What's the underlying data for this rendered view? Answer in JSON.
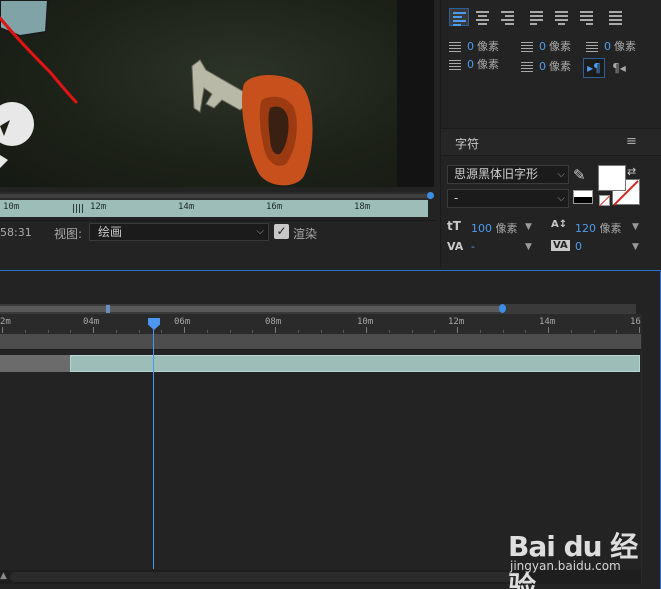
{
  "viewer": {
    "ruler_labels": [
      "10m",
      "12m",
      "14m",
      "16m",
      "18m"
    ],
    "timecode_fragment": "58:31",
    "view_label": "视图:",
    "view_value": "绘画",
    "render_label": "渲染"
  },
  "paragraph": {
    "indent_left": {
      "value": "0",
      "unit": "像素"
    },
    "indent_first": {
      "value": "0",
      "unit": "像素"
    },
    "indent_right": {
      "value": "0",
      "unit": "像素"
    },
    "space_before": {
      "value": "0",
      "unit": "像素"
    },
    "space_after": {
      "value": "0",
      "unit": "像素"
    },
    "ltr_symbol": "▸¶",
    "rtl_symbol": "¶◂"
  },
  "character": {
    "title": "字符",
    "menu_symbol": "≡",
    "font_family": "思源黑体旧字形",
    "font_style": "-",
    "font_size": {
      "value": "100",
      "unit": "像素"
    },
    "leading": {
      "value": "120",
      "unit": "像素"
    },
    "kerning": "-",
    "tracking": "0",
    "colors": {
      "fill": "#ffffff",
      "stroke": "#ffffff",
      "stroke_slash": "#dd2222"
    }
  },
  "timeline": {
    "ruler_labels": [
      "2m",
      "04m",
      "06m",
      "08m",
      "10m",
      "12m",
      "14m",
      "16"
    ],
    "accent": "#4b96ee",
    "layer_color": "#9dbdb8"
  },
  "watermark": {
    "logo": "Bai du 经验",
    "url": "jingyan.baidu.com"
  }
}
